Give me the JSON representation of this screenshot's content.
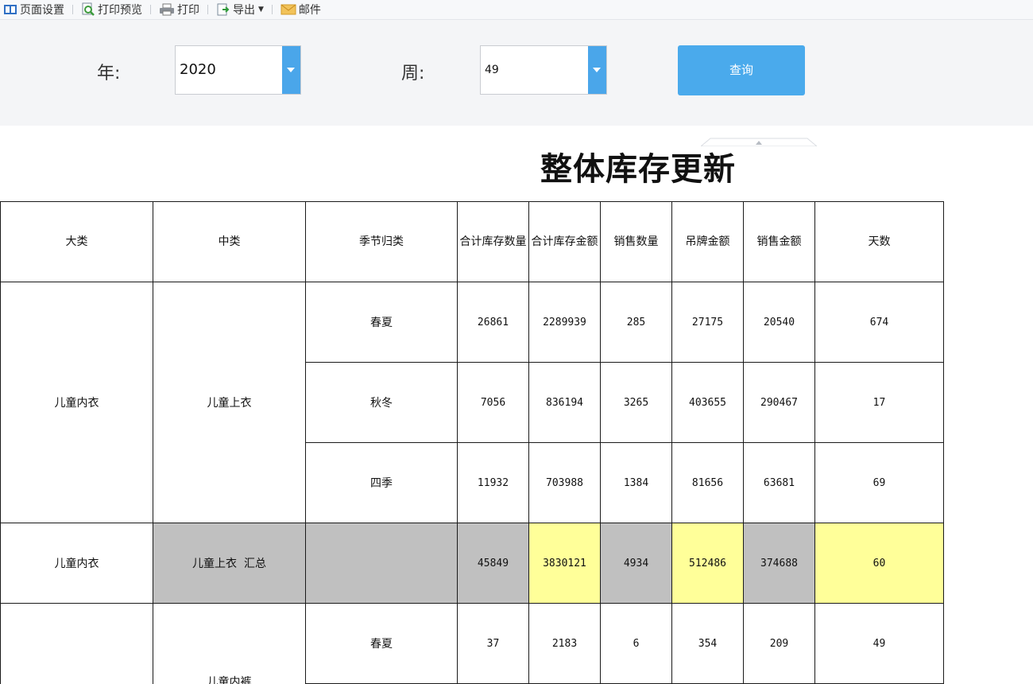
{
  "toolbar": {
    "page_setup": "页面设置",
    "print_preview": "打印预览",
    "print": "打印",
    "export": "导出",
    "mail": "邮件"
  },
  "query": {
    "year_label": "年:",
    "year_value": "2020",
    "week_label": "周:",
    "week_value": "49",
    "search_button": "查询"
  },
  "report": {
    "title": "整体库存更新",
    "headers": [
      "大类",
      "中类",
      "季节归类",
      "合计库存数量",
      "合计库存金额",
      "销售数量",
      "吊牌金额",
      "销售金额",
      "天数"
    ],
    "group1": {
      "major": "儿童内衣",
      "mid": "儿童上衣",
      "rows": [
        {
          "season": "春夏",
          "qty": "26861",
          "amount": "2289939",
          "sales_qty": "285",
          "tag_amount": "27175",
          "sales_amount": "20540",
          "days": "674"
        },
        {
          "season": "秋冬",
          "qty": "7056",
          "amount": "836194",
          "sales_qty": "3265",
          "tag_amount": "403655",
          "sales_amount": "290467",
          "days": "17"
        },
        {
          "season": "四季",
          "qty": "11932",
          "amount": "703988",
          "sales_qty": "1384",
          "tag_amount": "81656",
          "sales_amount": "63681",
          "days": "69"
        }
      ]
    },
    "subtotal": {
      "major": "儿童内衣",
      "mid": "儿童上衣  汇总",
      "season": "",
      "qty": "45849",
      "amount": "3830121",
      "sales_qty": "4934",
      "tag_amount": "512486",
      "sales_amount": "374688",
      "days": "60"
    },
    "group2": {
      "mid": "儿童内裤",
      "rows": [
        {
          "season": "春夏",
          "qty": "37",
          "amount": "2183",
          "sales_qty": "6",
          "tag_amount": "354",
          "sales_amount": "209",
          "days": "49"
        }
      ]
    },
    "colors": {
      "subtotal_gray": "#c0c0c0",
      "subtotal_yellow": "#ffff99",
      "button_blue": "#4aaaec"
    }
  }
}
